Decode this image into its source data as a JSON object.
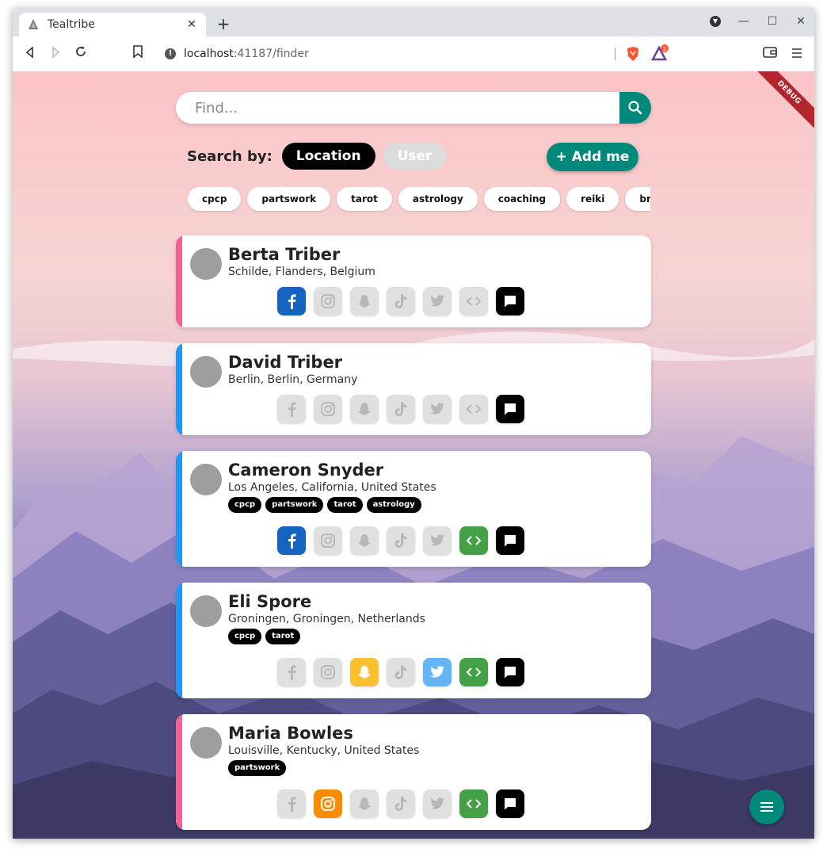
{
  "browser": {
    "tab_title": "Tealtribe",
    "url_host": "localhost",
    "url_rest": ":41187/finder",
    "icons": [
      "back-icon",
      "forward-icon",
      "reload-icon",
      "bookmark-icon",
      "info-icon",
      "brave-shield-icon",
      "brave-rewards-icon",
      "wallet-icon",
      "menu-icon"
    ]
  },
  "page": {
    "debug_label": "DEBUG",
    "search_placeholder": "Find...",
    "search_by_label": "Search by:",
    "location_label": "Location",
    "user_label": "User",
    "add_me_label": "+ Add me",
    "tags": [
      "cpcp",
      "partswork",
      "tarot",
      "astrology",
      "coaching",
      "reiki",
      "breath"
    ]
  },
  "colors": {
    "teal": "#00897b",
    "pink_accent": "#f06292",
    "blue_accent": "#2196f3"
  },
  "cards": [
    {
      "name": "Berta Triber",
      "location": "Schilde, Flanders, Belgium",
      "tags": [],
      "accent": "#f06292",
      "socials": {
        "facebook": true,
        "instagram": false,
        "snapchat": false,
        "tiktok": false,
        "twitter": false,
        "web": false,
        "chat": true
      }
    },
    {
      "name": "David Triber",
      "location": "Berlin, Berlin, Germany",
      "tags": [],
      "accent": "#2196f3",
      "socials": {
        "facebook": false,
        "instagram": false,
        "snapchat": false,
        "tiktok": false,
        "twitter": false,
        "web": false,
        "chat": true
      }
    },
    {
      "name": "Cameron Snyder",
      "location": "Los Angeles, California, United States",
      "tags": [
        "cpcp",
        "partswork",
        "tarot",
        "astrology"
      ],
      "accent": "#2196f3",
      "socials": {
        "facebook": true,
        "instagram": false,
        "snapchat": false,
        "tiktok": false,
        "twitter": false,
        "web": true,
        "chat": true
      }
    },
    {
      "name": "Eli Spore",
      "location": "Groningen, Groningen, Netherlands",
      "tags": [
        "cpcp",
        "tarot"
      ],
      "accent": "#2196f3",
      "socials": {
        "facebook": false,
        "instagram": false,
        "snapchat": true,
        "tiktok": false,
        "twitter": true,
        "web": true,
        "chat": true
      }
    },
    {
      "name": "Maria Bowles",
      "location": "Louisville, Kentucky, United States",
      "tags": [
        "partswork"
      ],
      "accent": "#f06292",
      "socials": {
        "facebook": false,
        "instagram": true,
        "snapchat": false,
        "tiktok": false,
        "twitter": false,
        "web": true,
        "chat": true
      }
    }
  ]
}
